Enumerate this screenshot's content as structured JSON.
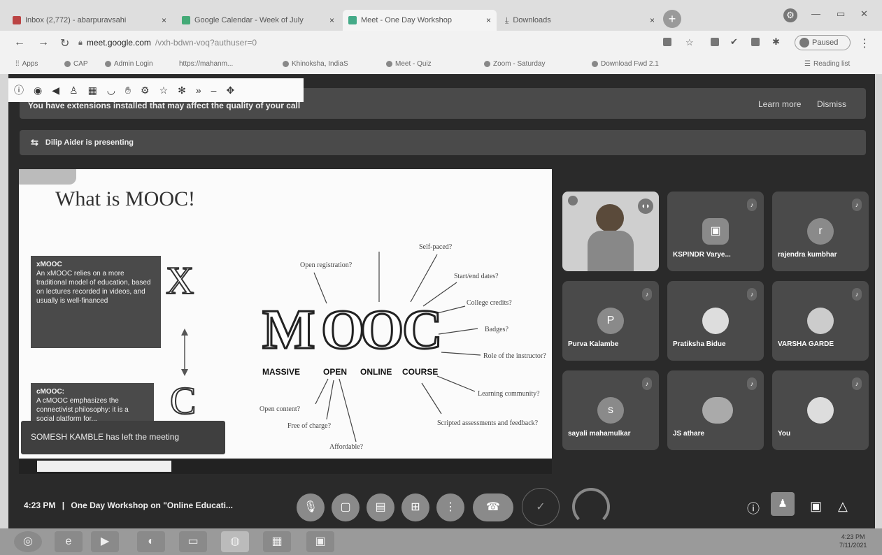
{
  "browser": {
    "tabs": [
      {
        "label": "Inbox (2,772) - abarpuravsahi"
      },
      {
        "label": "Google Calendar - Week of July"
      },
      {
        "label": "Meet - One Day Workshop"
      },
      {
        "label": "Downloads"
      }
    ],
    "url_host": "meet.google.com",
    "url_path": "/vxh-bdwn-voq?authuser=0",
    "paused_label": "Paused",
    "bookmarks": [
      "Apps",
      "CAP",
      "Admin Login",
      "https://mahanm...",
      "Khinoksha, IndiaS",
      "Meet - Quiz",
      "Zoom - Saturday",
      "Download Fwd 2.1"
    ],
    "reading_list": "Reading list"
  },
  "banner": {
    "message": "You have extensions installed that may affect the quality of your call",
    "learn_more": "Learn more",
    "dismiss": "Dismiss"
  },
  "presenting_text": "Dilip Aider is presenting",
  "slide": {
    "title": "What is MOOC!",
    "xmooc_title": "xMOOC",
    "xmooc_text": "An xMOOC relies on a more traditional model of education, based on lectures recorded in videos, and usually is well-financed",
    "cmooc_title": "cMOOC:",
    "cmooc_text": "A cMOOC emphasizes the connectivist philosophy: it is a social platform for...",
    "big_letters": [
      "M",
      "O",
      "O",
      "C"
    ],
    "words": [
      "MASSIVE",
      "OPEN",
      "ONLINE",
      "COURSE"
    ],
    "mindmap": [
      "Open registration?",
      "Self-paced?",
      "Start/end dates?",
      "College credits?",
      "Badges?",
      "Role of the instructor?",
      "Learning community?",
      "Scripted assessments and feedback?",
      "Open content?",
      "Free of charge?",
      "Affordable?"
    ]
  },
  "toast": "SOMESH KAMBLE has left the meeting",
  "tiles": [
    {
      "name": "",
      "initial": ""
    },
    {
      "name": "KSPINDR Varye...",
      "initial": ""
    },
    {
      "name": "rajendra kumbhar",
      "initial": "r"
    },
    {
      "name": "Purva Kalambe",
      "initial": "P"
    },
    {
      "name": "Pratiksha Bidue",
      "initial": ""
    },
    {
      "name": "VARSHA GARDE",
      "initial": ""
    },
    {
      "name": "sayali mahamulkar",
      "initial": "s"
    },
    {
      "name": "JS athare",
      "initial": ""
    },
    {
      "name": "You",
      "initial": ""
    }
  ],
  "meeting": {
    "time": "4:23 PM",
    "title": "One Day Workshop on \"Online Educati..."
  },
  "taskbar": {
    "time": "4:23 PM",
    "date": "7/11/2021"
  }
}
